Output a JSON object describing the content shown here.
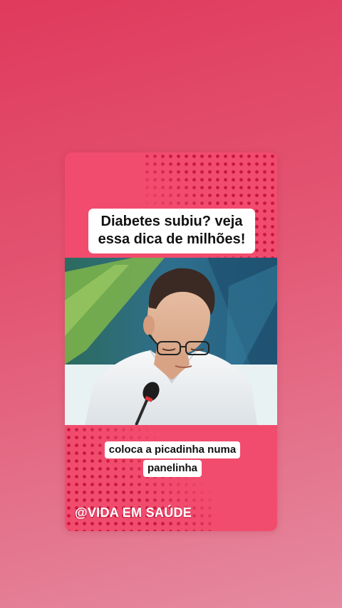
{
  "post": {
    "headline_line1": "Diabetes subiu? veja",
    "headline_line2": "essa dica de milhões!",
    "caption_line1": "coloca a picadinha numa",
    "caption_line2": "panelinha",
    "watermark": "@VIDA EM SAÚDE"
  },
  "colors": {
    "background_top": "#e03a5c",
    "background_bottom": "#e58aa0",
    "card": "#f14c6e",
    "dots": "#c7173f",
    "caption_bg": "#ffffff"
  }
}
